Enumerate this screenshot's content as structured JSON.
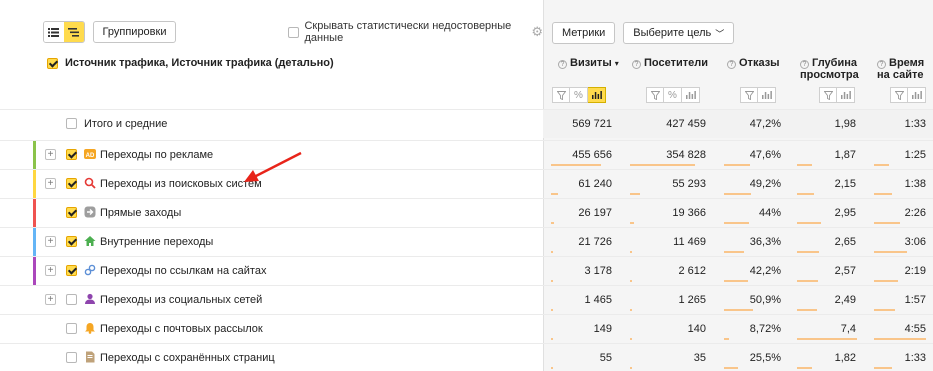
{
  "toolbar": {
    "view_list_icon": "list-view-icon",
    "view_tree_icon": "tree-view-icon",
    "group_label": "Группировки",
    "hide_stat_label": "Скрывать статистически недостоверные данные",
    "metrics_label": "Метрики",
    "goal_label": "Выберите цель"
  },
  "dimension_header": "Источник трафика, Источник трафика (детально)",
  "columns": [
    {
      "label": "Визиты",
      "sorted": "▾"
    },
    {
      "label": "Посетители"
    },
    {
      "label": "Отказы"
    },
    {
      "label_line1": "Глубина",
      "label_line2": "просмотра"
    },
    {
      "label_line1": "Время",
      "label_line2": "на сайте"
    }
  ],
  "rows": [
    {
      "label": "Итого и средние",
      "visits": "569 721",
      "visitors": "427 459",
      "bounce": "47,2%",
      "depth": "1,98",
      "time": "1:33"
    },
    {
      "label": "Переходы по рекламе",
      "visits": "455 656",
      "visitors": "354 828",
      "bounce": "47,6%",
      "depth": "1,87",
      "time": "1:25",
      "color": "#8bc34a",
      "icon": "ad-icon"
    },
    {
      "label": "Переходы из поисковых систем",
      "visits": "61 240",
      "visitors": "55 293",
      "bounce": "49,2%",
      "depth": "2,15",
      "time": "1:38",
      "color": "#ffd740",
      "icon": "search-icon"
    },
    {
      "label": "Прямые заходы",
      "visits": "26 197",
      "visitors": "19 366",
      "bounce": "44%",
      "depth": "2,95",
      "time": "2:26",
      "color": "#ef5350",
      "icon": "direct-icon"
    },
    {
      "label": "Внутренние переходы",
      "visits": "21 726",
      "visitors": "11 469",
      "bounce": "36,3%",
      "depth": "2,65",
      "time": "3:06",
      "color": "#64b5f6",
      "icon": "home-icon"
    },
    {
      "label": "Переходы по ссылкам на сайтах",
      "visits": "3 178",
      "visitors": "2 612",
      "bounce": "42,2%",
      "depth": "2,57",
      "time": "2:19",
      "color": "#ab47bc",
      "icon": "link-icon"
    },
    {
      "label": "Переходы из социальных сетей",
      "visits": "1 465",
      "visitors": "1 265",
      "bounce": "50,9%",
      "depth": "2,49",
      "time": "1:57",
      "icon": "social-icon"
    },
    {
      "label": "Переходы с почтовых рассылок",
      "visits": "149",
      "visitors": "140",
      "bounce": "8,72%",
      "depth": "7,4",
      "time": "4:55",
      "icon": "mail-icon"
    },
    {
      "label": "Переходы с сохранённых страниц",
      "visits": "55",
      "visitors": "35",
      "bounce": "25,5%",
      "depth": "1,82",
      "time": "1:33",
      "icon": "saved-page-icon"
    }
  ],
  "bars": {
    "visits_share": [
      0.8,
      0.11,
      0.05,
      0.04,
      0.01,
      0.003,
      0.0003,
      0.0001
    ],
    "visitors_share": [
      0.83,
      0.13,
      0.05,
      0.03,
      0.006,
      0.003,
      0.0003,
      0.0001
    ],
    "bounce_share": [
      0.47,
      0.49,
      0.44,
      0.36,
      0.42,
      0.51,
      0.09,
      0.25
    ],
    "depth_share": [
      0.25,
      0.29,
      0.4,
      0.36,
      0.35,
      0.34,
      1.0,
      0.25
    ],
    "time_share": [
      0.29,
      0.34,
      0.5,
      0.63,
      0.47,
      0.4,
      1.0,
      0.34
    ]
  },
  "annotation": {
    "arrow_color": "#e8241a"
  }
}
